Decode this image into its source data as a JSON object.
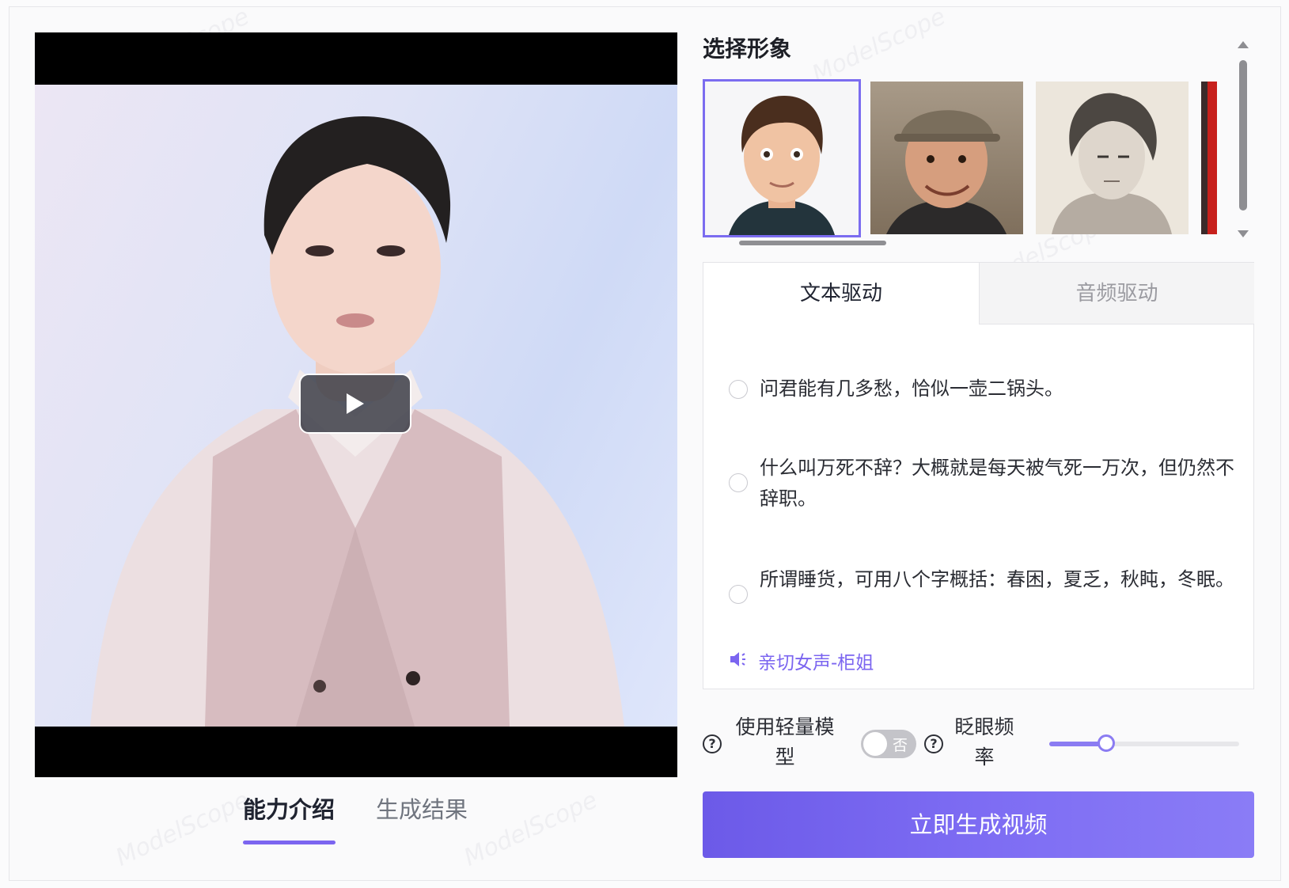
{
  "left_tabs": {
    "intro_label": "能力介绍",
    "result_label": "生成结果",
    "active": "能力介绍"
  },
  "avatar_section": {
    "title": "选择形象",
    "avatars": [
      {
        "name": "cartoon-boy",
        "selected": true
      },
      {
        "name": "man-with-cap",
        "selected": false
      },
      {
        "name": "sketch-youth",
        "selected": false
      },
      {
        "name": "partially-hidden",
        "selected": false
      }
    ]
  },
  "drive_tabs": {
    "text_label": "文本驱动",
    "audio_label": "音频驱动",
    "active": "文本驱动"
  },
  "text_options": [
    "问君能有几多愁，恰似一壶二锅头。",
    "什么叫万死不辞？大概就是每天被气死一万次，但仍然不辞职。",
    "所谓睡货，可用八个字概括：春困，夏乏，秋盹，冬眠。"
  ],
  "voice": {
    "label": "亲切女声-柜姐",
    "icon": "speaker-icon"
  },
  "settings": {
    "light_model_label": "使用轻量模型",
    "light_model_toggle_text": "否",
    "light_model_enabled": false,
    "blink_label": "眨眼频率",
    "blink_value": 0.3
  },
  "generate_button": "立即生成视频",
  "watermark": "ModelScope",
  "colors": {
    "accent": "#7b65f0",
    "button": "#7565ee",
    "toggle_off": "#c4c4c9"
  }
}
